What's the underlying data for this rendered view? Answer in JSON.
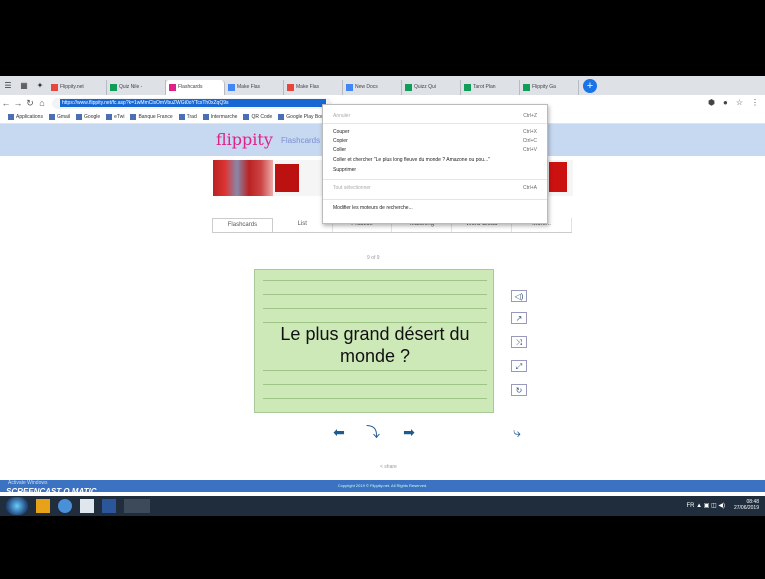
{
  "browser": {
    "tabs": [
      {
        "label": "Flippity.net",
        "color": "#e8453c"
      },
      {
        "label": "Quiz Nile -",
        "color": "#0f9d58"
      },
      {
        "label": "Flashcards",
        "color": "#e0218a",
        "active": true
      },
      {
        "label": "Make Flas",
        "color": "#4285f4"
      },
      {
        "label": "Make Flas",
        "color": "#e8453c"
      },
      {
        "label": "New Docs",
        "color": "#4285f4"
      },
      {
        "label": "Quizz Qui",
        "color": "#0f9d58"
      },
      {
        "label": "Tarot Plan",
        "color": "#0f9d58"
      },
      {
        "label": "Flippity Ga",
        "color": "#0f9d58"
      }
    ],
    "new_tab": "+",
    "url": "https://www.flippity.net/fc.asp?k=1wMmClsOmVbuZWGt0oYTcxTh0xZqQ9s",
    "bookmarks": [
      "Applications",
      "Gmail",
      "Google",
      "eTwi",
      "Banque France",
      "Trad",
      "Intermarche",
      "QR Code",
      "Google Play Books"
    ]
  },
  "context_menu": {
    "items": [
      {
        "label": "Annuler",
        "shortcut": "Ctrl+Z"
      },
      {
        "label": "Couper",
        "shortcut": "Ctrl+X"
      },
      {
        "label": "Copier",
        "shortcut": "Ctrl+C"
      },
      {
        "label": "Coller",
        "shortcut": "Ctrl+V"
      },
      {
        "label": "Coller et chercher \"Le plus long fleuve du monde ? Amazone ou pou...\"",
        "shortcut": ""
      },
      {
        "label": "Supprimer",
        "shortcut": ""
      },
      {
        "label": "Tout sélectionner",
        "shortcut": "Ctrl+A"
      },
      {
        "label": "Modifier les moteurs de recherche...",
        "shortcut": ""
      }
    ]
  },
  "page": {
    "logo": "flippity",
    "subtitle": "Flashcards",
    "tabs": [
      "Flashcards",
      "List",
      "Practice",
      "Matching",
      "Word Cloud",
      "More..."
    ],
    "counter": "9 of 9",
    "card_text": "Le plus grand désert du monde ?",
    "share": "< share",
    "footer": "Copyright 2019 © Flippity.net. All Rights Reserved.",
    "watermark": "Activate Windows"
  },
  "taskbar": {
    "screencast_label": "SCREENCAST O MATIC",
    "language": "FR",
    "time": "08:48",
    "date": "27/06/2019"
  }
}
